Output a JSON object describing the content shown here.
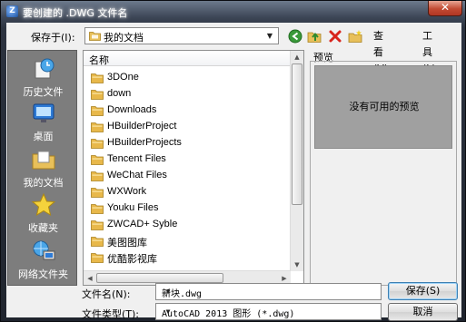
{
  "window": {
    "title": "要创建的 .DWG 文件名",
    "close_glyph": "✕"
  },
  "save_in": {
    "label": "保存于(I):",
    "value": "我的文档"
  },
  "toolbar": {
    "view_label": "查看(V)",
    "tools_label": "工具(L)",
    "icons": [
      "back-icon",
      "up-folder-icon",
      "delete-icon",
      "new-folder-icon"
    ]
  },
  "places": [
    {
      "label": "历史文件",
      "icon": "history-icon"
    },
    {
      "label": "桌面",
      "icon": "desktop-icon"
    },
    {
      "label": "我的文档",
      "icon": "my-documents-icon"
    },
    {
      "label": "收藏夹",
      "icon": "favorites-star-icon"
    },
    {
      "label": "网络文件夹",
      "icon": "network-folder-icon"
    }
  ],
  "file_list": {
    "header": "名称",
    "items": [
      "3DOne",
      "down",
      "Downloads",
      "HBuilderProject",
      "HBuilderProjects",
      "Tencent Files",
      "WeChat Files",
      "WXWork",
      "Youku Files",
      "ZWCAD+ Syble",
      "美图图库",
      "优酷影视库"
    ]
  },
  "preview": {
    "label": "预览",
    "message": "没有可用的预览"
  },
  "file_name": {
    "label": "文件名(N):",
    "value": "新块.dwg"
  },
  "file_type": {
    "label": "文件类型(T):",
    "value": "AutoCAD 2013 图形 (*.dwg)"
  },
  "buttons": {
    "save": "保存(S)",
    "cancel": "取消"
  },
  "colors": {
    "folder": "#e8b84a",
    "places_bg": "#7d7d7d",
    "preview_bg": "#a0a0a0",
    "title_gradient_top": "#6d7a8c"
  }
}
